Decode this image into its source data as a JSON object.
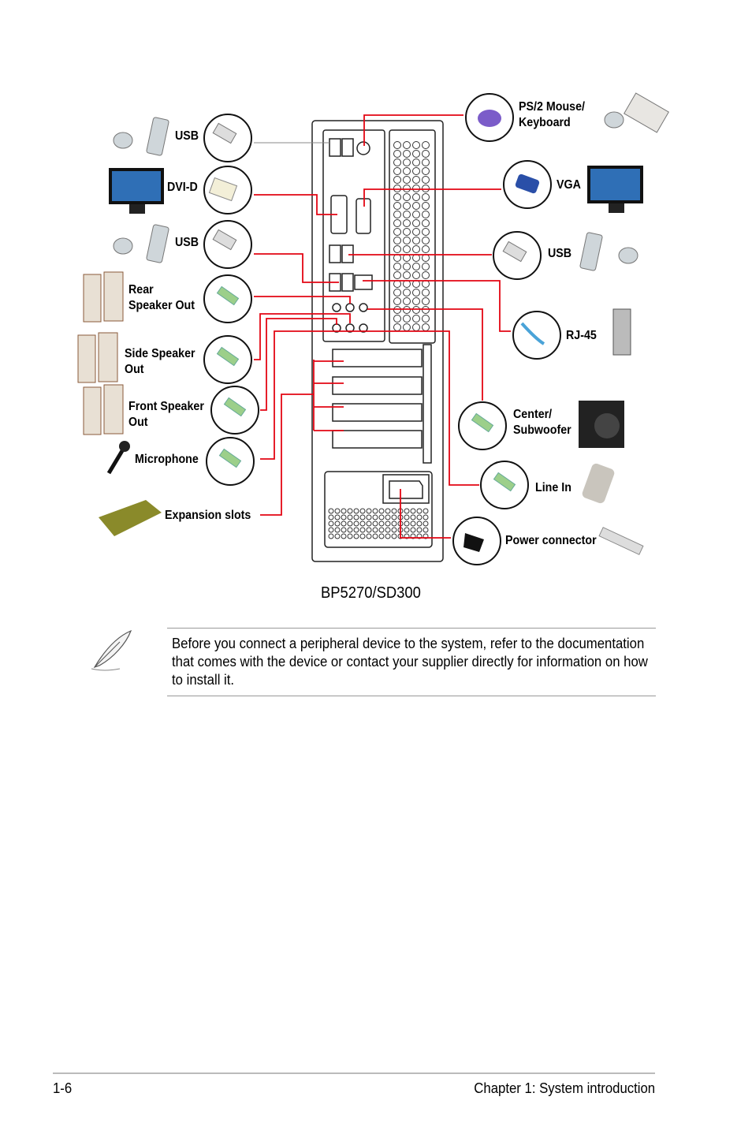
{
  "diagram": {
    "model": "BP5270/SD300",
    "left_labels": [
      {
        "line1": "USB",
        "line2": ""
      },
      {
        "line1": "DVI-D",
        "line2": ""
      },
      {
        "line1": "USB",
        "line2": ""
      },
      {
        "line1": "Rear",
        "line2": "Speaker Out"
      },
      {
        "line1": "Side Speaker",
        "line2": "Out"
      },
      {
        "line1": "Front Speaker",
        "line2": "Out"
      },
      {
        "line1": "Microphone",
        "line2": ""
      },
      {
        "line1": "Expansion slots",
        "line2": ""
      }
    ],
    "right_labels": [
      {
        "line1": "PS/2 Mouse/",
        "line2": "Keyboard"
      },
      {
        "line1": "VGA",
        "line2": ""
      },
      {
        "line1": "USB",
        "line2": ""
      },
      {
        "line1": "RJ-45",
        "line2": ""
      },
      {
        "line1": "Center/",
        "line2": "Subwoofer"
      },
      {
        "line1": "Line In",
        "line2": ""
      },
      {
        "line1": "Power connector",
        "line2": ""
      }
    ],
    "line_color": "#e30613"
  },
  "note": {
    "icon": "feather-pen-icon",
    "text": "Before you connect a peripheral device to the system, refer to the documentation that comes with the device or contact your supplier directly for information on how to install it."
  },
  "footer": {
    "page_number": "1-6",
    "chapter": "Chapter 1: System introduction"
  }
}
